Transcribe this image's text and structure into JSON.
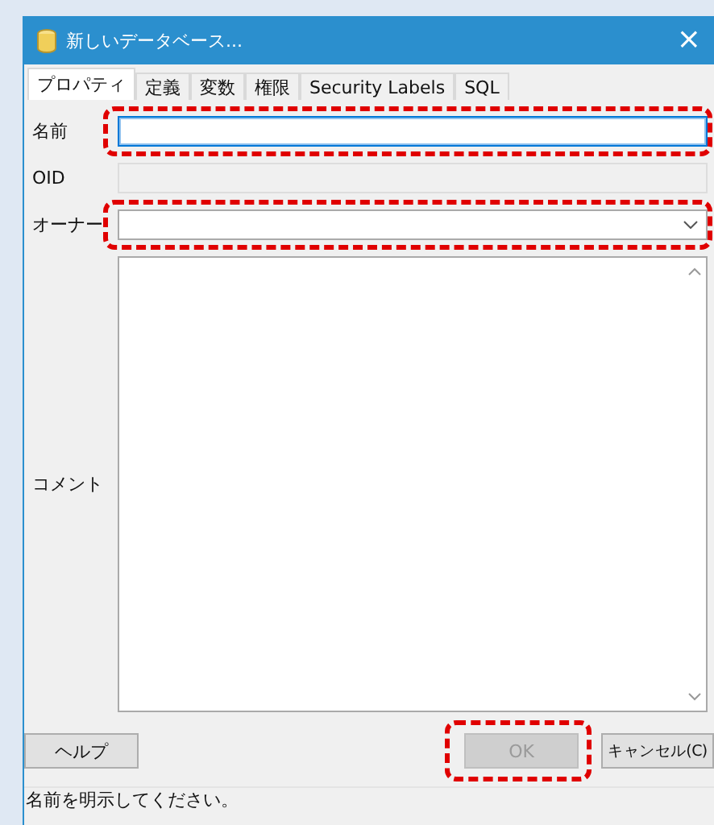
{
  "window": {
    "title": "新しいデータベース...",
    "close": "×"
  },
  "tabs": [
    {
      "label": "プロパティ",
      "selected": true
    },
    {
      "label": "定義",
      "selected": false
    },
    {
      "label": "変数",
      "selected": false
    },
    {
      "label": "権限",
      "selected": false
    },
    {
      "label": "Security Labels",
      "selected": false
    },
    {
      "label": "SQL",
      "selected": false
    }
  ],
  "fields": [
    {
      "label": "名前",
      "kind": "text",
      "disabled": false,
      "focused": true,
      "highlighted": true
    },
    {
      "label": "OID",
      "kind": "text",
      "disabled": true,
      "highlighted": false
    },
    {
      "label": "オーナー",
      "kind": "dropdown",
      "disabled": false,
      "highlighted": true
    },
    {
      "label": "コメント",
      "kind": "textarea",
      "disabled": false,
      "highlighted": false
    }
  ],
  "buttons": [
    {
      "label": "ヘルプ",
      "disabled": false,
      "highlighted": false
    },
    {
      "label": "OK",
      "disabled": true,
      "highlighted": true
    },
    {
      "label": "キャンセル(C)",
      "disabled": false,
      "highlighted": false
    }
  ],
  "status_bar": "名前を明示してください。"
}
